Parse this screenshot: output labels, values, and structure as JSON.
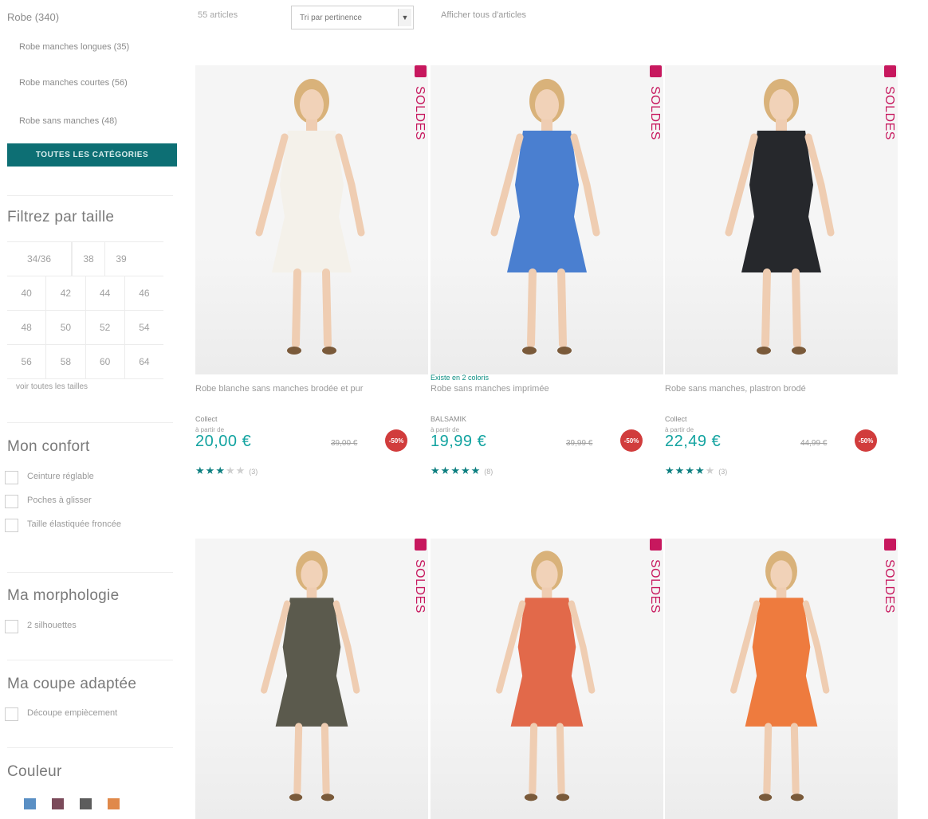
{
  "sidebar": {
    "category_title": "Robe (340)",
    "subcategories": [
      "Robe manches longues (35)",
      "Robe manches courtes (56)",
      "Robe sans manches (48)"
    ],
    "all_categories_button": "TOUTES LES CATÉGORIES",
    "size_filter": {
      "title": "Filtrez par taille",
      "sizes_row1": [
        "34/36",
        "38",
        "39"
      ],
      "sizes": [
        [
          "40",
          "42",
          "44",
          "46"
        ],
        [
          "48",
          "50",
          "52",
          "54"
        ],
        [
          "56",
          "58",
          "60",
          "64"
        ]
      ],
      "see_all_link": "voir toutes les tailles"
    },
    "comfort": {
      "title": "Mon confort",
      "options": [
        "Ceinture réglable",
        "Poches à glisser",
        "Taille élastiquée froncée"
      ]
    },
    "morphology": {
      "title": "Ma morphologie",
      "options": [
        "2 silhouettes"
      ]
    },
    "fit": {
      "title": "Ma coupe adaptée",
      "options": [
        "Découpe empiècement"
      ]
    },
    "color": {
      "title": "Couleur",
      "swatches": [
        "#5a8fc4",
        "#7b4a5a",
        "#5c5c5c",
        "#e0894a"
      ]
    }
  },
  "topbar": {
    "article_count": "55 articles",
    "sort_value": "Tri par pertinence",
    "sort_arrow": "▼",
    "toggle_all": "Afficher tous d'articles"
  },
  "products": [
    {
      "note": "",
      "name": "Robe blanche sans manches brodée et pur",
      "brand": "Collect",
      "from": "à partir de",
      "price": "20,00 €",
      "old_price": "39,00 €",
      "discount": "-50%",
      "badge": "SOLDES",
      "rating": 3,
      "review_count": "(3)",
      "dress_color": "#f4f1ea"
    },
    {
      "note": "Existe en 2 coloris",
      "name": "Robe sans manches imprimée",
      "brand": "BALSAMIK",
      "from": "à partir de",
      "price": "19,99 €",
      "old_price": "39,99 €",
      "discount": "-50%",
      "badge": "SOLDES",
      "rating": 5,
      "review_count": "(8)",
      "dress_color": "#4a7fd0"
    },
    {
      "note": "",
      "name": "Robe sans manches, plastron brodé",
      "brand": "Collect",
      "from": "à partir de",
      "price": "22,49 €",
      "old_price": "44,99 €",
      "discount": "-50%",
      "badge": "SOLDES",
      "rating": 4,
      "review_count": "(3)",
      "dress_color": "#26282c"
    },
    {
      "badge": "SOLDES",
      "dress_color": "#5b5a4d"
    },
    {
      "badge": "SOLDES",
      "dress_color": "#e2694a"
    },
    {
      "badge": "SOLDES",
      "dress_color": "#ee7b3e"
    }
  ]
}
